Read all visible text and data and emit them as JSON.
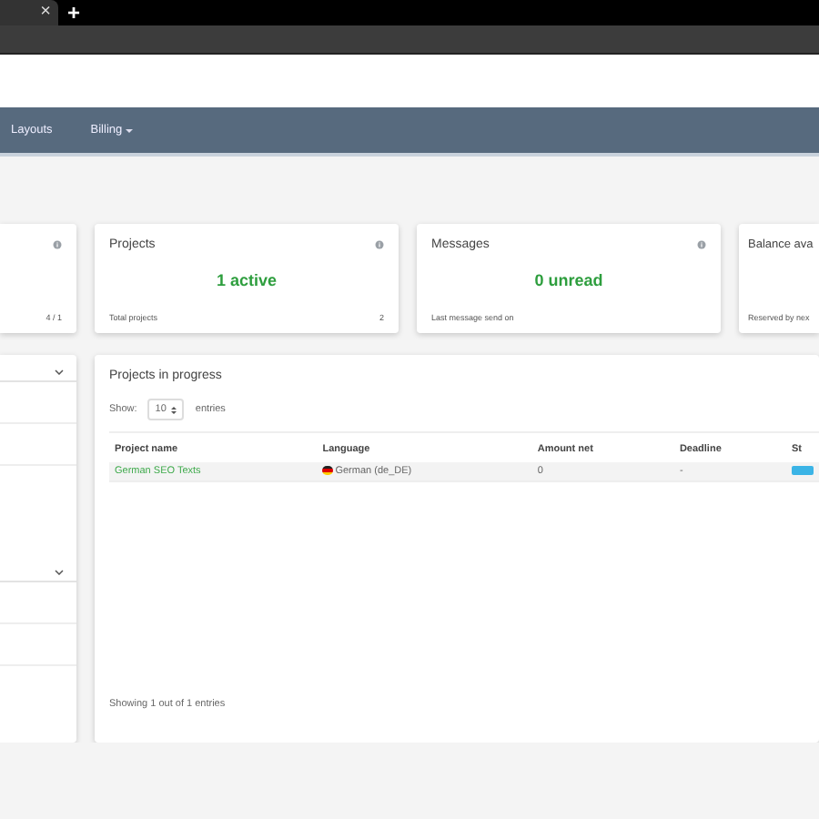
{
  "browser": {
    "tab_close": "×",
    "new_tab": "+"
  },
  "nav": {
    "items": [
      {
        "label": "Layouts",
        "dropdown": false
      },
      {
        "label": "Billing",
        "dropdown": true
      }
    ]
  },
  "stat_cards": [
    {
      "footer_value": "4 / 1",
      "info": true
    },
    {
      "title": "Projects",
      "value": "1 active",
      "footer_label": "Total projects",
      "footer_value": "2",
      "info": true
    },
    {
      "title": "Messages",
      "value": "0 unread",
      "footer_label": "Last message send on",
      "info": true
    },
    {
      "title": "Balance ava",
      "footer_label": "Reserved by nex",
      "info": false
    }
  ],
  "side_panel": {
    "sections": [
      {
        "expanded": false
      },
      {
        "expanded": false
      }
    ]
  },
  "projects_panel": {
    "title": "Projects in progress",
    "show_label": "Show:",
    "page_size": "10",
    "entries_label": "entries",
    "table": {
      "columns": [
        "Project name",
        "Language",
        "Amount net",
        "Deadline",
        "St"
      ],
      "rows": [
        {
          "project": "German SEO Texts",
          "language": "German (de_DE)",
          "amount": "0",
          "deadline": "-"
        }
      ]
    },
    "footer": "Showing 1 out of 1 entries"
  }
}
